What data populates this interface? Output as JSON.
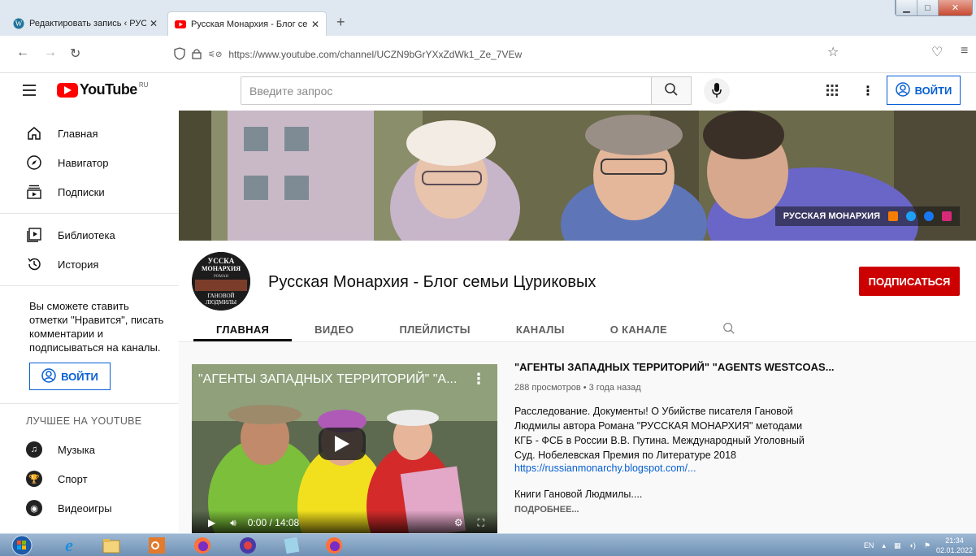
{
  "browser": {
    "tabs": [
      {
        "title": "Редактировать запись ‹ РУССК",
        "close": "✕"
      },
      {
        "title": "Русская Монархия - Блог семь",
        "close": "✕"
      }
    ],
    "new_tab": "+",
    "url": "https://www.youtube.com/channel/UCZN9bGrYXxZdWk1_Ze_7VEw"
  },
  "yt": {
    "logo": "YouTube",
    "region": "RU",
    "search_placeholder": "Введите запрос",
    "signin": "ВОЙТИ"
  },
  "sidebar": {
    "items": [
      {
        "label": "Главная",
        "icon": "home-icon"
      },
      {
        "label": "Навигатор",
        "icon": "compass-icon"
      },
      {
        "label": "Подписки",
        "icon": "subscriptions-icon"
      }
    ],
    "items2": [
      {
        "label": "Библиотека",
        "icon": "library-icon"
      },
      {
        "label": "История",
        "icon": "history-icon"
      }
    ],
    "note": "Вы сможете ставить отметки \"Нравится\", писать комментарии и подписываться на каналы.",
    "signin": "ВОЙТИ",
    "best_header": "ЛУЧШЕЕ НА YOUTUBE",
    "best": [
      {
        "label": "Музыка",
        "icon": "music-icon"
      },
      {
        "label": "Спорт",
        "icon": "sport-icon"
      },
      {
        "label": "Видеоигры",
        "icon": "gaming-icon"
      }
    ]
  },
  "channel": {
    "banner_label": "РУССКАЯ МОНАРХИЯ",
    "title": "Русская Монархия - Блог семьи Цуриковых",
    "subscribe": "ПОДПИСАТЬСЯ",
    "avatar_lines": [
      "УССКА",
      "МОНАРХИЯ",
      "РОМАН",
      "ГАНОВОЙ",
      "ЛЮДМИЛЫ"
    ],
    "tabs": [
      "ГЛАВНАЯ",
      "ВИДЕО",
      "ПЛЕЙЛИСТЫ",
      "КАНАЛЫ",
      "О КАНАЛЕ"
    ]
  },
  "featured": {
    "player_title": "\"АГЕНТЫ ЗАПАДНЫХ ТЕРРИТОРИЙ\" \"А...",
    "time": "0:00 / 14:08",
    "title": "\"АГЕНТЫ ЗАПАДНЫХ ТЕРРИТОРИЙ\" \"AGENTS WESTCOAS...",
    "meta": "288 просмотров • 3 года назад",
    "desc": "Расследование. Документы! О Убийстве писателя Гановой Людмилы автора Романа \"РУССКАЯ МОНАРХИЯ\" методами КГБ - ФСБ в России В.В. Путина. Международный Уголовный Суд. Нобелевская Премия по Литературе 2018",
    "link": "https://russianmonarchy.blogspot.com/...",
    "books": "Книги Гановой Людмилы....",
    "more": "ПОДРОБНЕЕ..."
  },
  "taskbar": {
    "lang": "EN",
    "time": "21:34",
    "date": "02.01.2022"
  },
  "colors": {
    "accent": "#065fd4",
    "subscribe": "#cc0000",
    "yt_red": "#ff0000"
  }
}
